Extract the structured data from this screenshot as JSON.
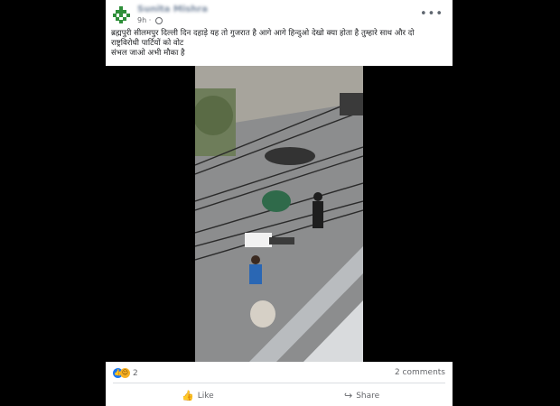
{
  "post": {
    "author": "Sunita Mishra",
    "time": "9h",
    "menu_icon": "more-options-icon",
    "caption_lines": [
      "ब्रह्मपुरी सीलमपुर दिल्ली दिन दहाड़े यह तो गुजरात है आगे आगे हिन्दुओ देखो क्या होता है तुम्हारे साथ और दो",
      "राष्ट्रविरोधी पार्टियों को वोट",
      "संभल जाओ अभी मौका है"
    ],
    "reaction_count": "2",
    "comments_label": "2 comments",
    "like_label": "Like",
    "share_label": "Share"
  },
  "colors": {
    "accent": "#1877f2",
    "haha": "#f7b125",
    "text": "#1c1e21",
    "muted": "#65676b"
  }
}
